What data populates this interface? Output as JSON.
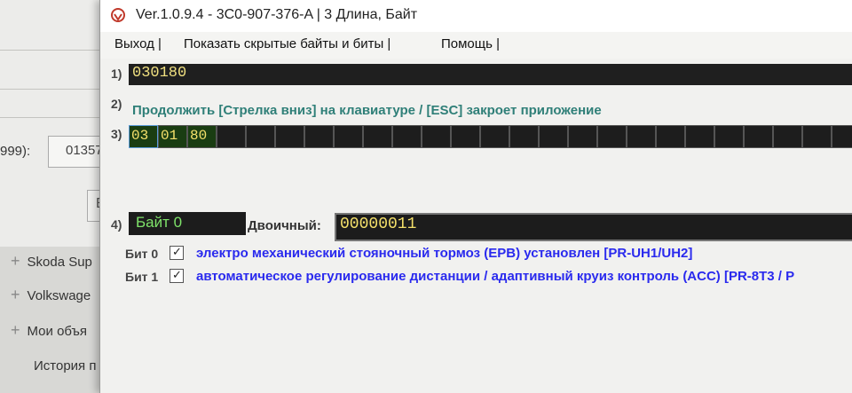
{
  "background": {
    "field_label": "999):",
    "field_value": "01357",
    "button_char": "E",
    "menu_items": [
      "Skoda Sup",
      "Volkswage",
      "Мои объя",
      "История п"
    ]
  },
  "window": {
    "title": "Ver.1.0.9.4 -    3C0-907-376-A | 3 Длина, Байт",
    "menu": {
      "exit": "Выход |",
      "show_hidden": "Показать скрытые байты и биты |",
      "help": "Помощь |"
    },
    "row1": {
      "num": "1)",
      "value": "030180"
    },
    "row2": {
      "num": "2)",
      "text": "Продолжить [Стрелка вниз] на клавиатуре / [ESC] закроет приложение"
    },
    "row3": {
      "num": "3)",
      "bytes": [
        "03",
        "01",
        "80"
      ],
      "empty_cells": 23
    },
    "row4": {
      "num": "4)",
      "byte_label": "Байт 0",
      "binary_label": "Двоичный:",
      "binary_value": "00000011"
    },
    "bits": [
      {
        "label": "Бит 0",
        "checked": true,
        "desc": "электро механический стояночный тормоз (EPB) установлен [PR-UH1/UH2]"
      },
      {
        "label": "Бит 1",
        "checked": true,
        "desc": "автоматическое регулирование дистанции / адаптивный круиз контроль (ACC) [PR-8T3 / P"
      }
    ]
  }
}
